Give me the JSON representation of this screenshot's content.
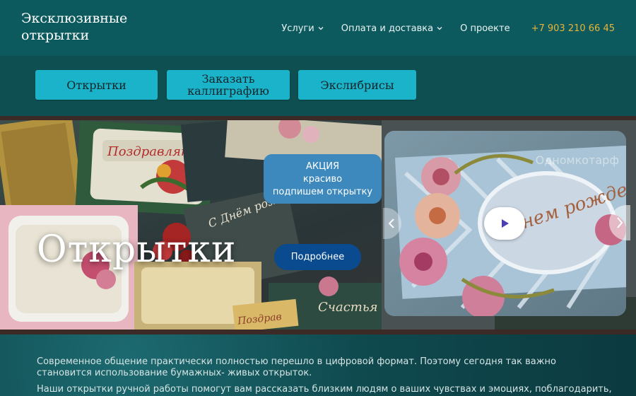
{
  "logo": {
    "line1": "Эксклюзивные",
    "line2": "открытки"
  },
  "nav": {
    "services": "Услуги",
    "delivery": "Оплата и доставка",
    "about": "О проекте",
    "phone": "+7 903 210 66 45"
  },
  "category_buttons": {
    "cards": "Открытки",
    "calligraphy_line1": "Заказать",
    "calligraphy_line2": "каллиграфию",
    "exlibris": "Экслибрисы"
  },
  "hero": {
    "promo_line1": "АКЦИЯ",
    "promo_line2": "красиво",
    "promo_line3": "подпишем открытку",
    "title": "Открытки",
    "more_button": "Подробнее",
    "video_watermark": "Одномкотарф"
  },
  "content": {
    "paragraph1": "Современное общение практически полностью перешло в цифровой формат. Поэтому сегодня так важно становится использование бумажных- живых открыток.",
    "paragraph2": "Наши открытки ручной работы помогут вам рассказать близким людям о ваших чувствах и эмоциях, поблагодарить,"
  },
  "colors": {
    "header_bg": "#0d5a5e",
    "button_bg": "#1ab3c9",
    "phone": "#e8b536",
    "promo_bg": "#3d89bd",
    "more_button_bg": "#0a4a8f"
  },
  "icons": [
    "chevron-down-icon",
    "play-icon",
    "chevron-left-icon",
    "chevron-right-icon"
  ]
}
